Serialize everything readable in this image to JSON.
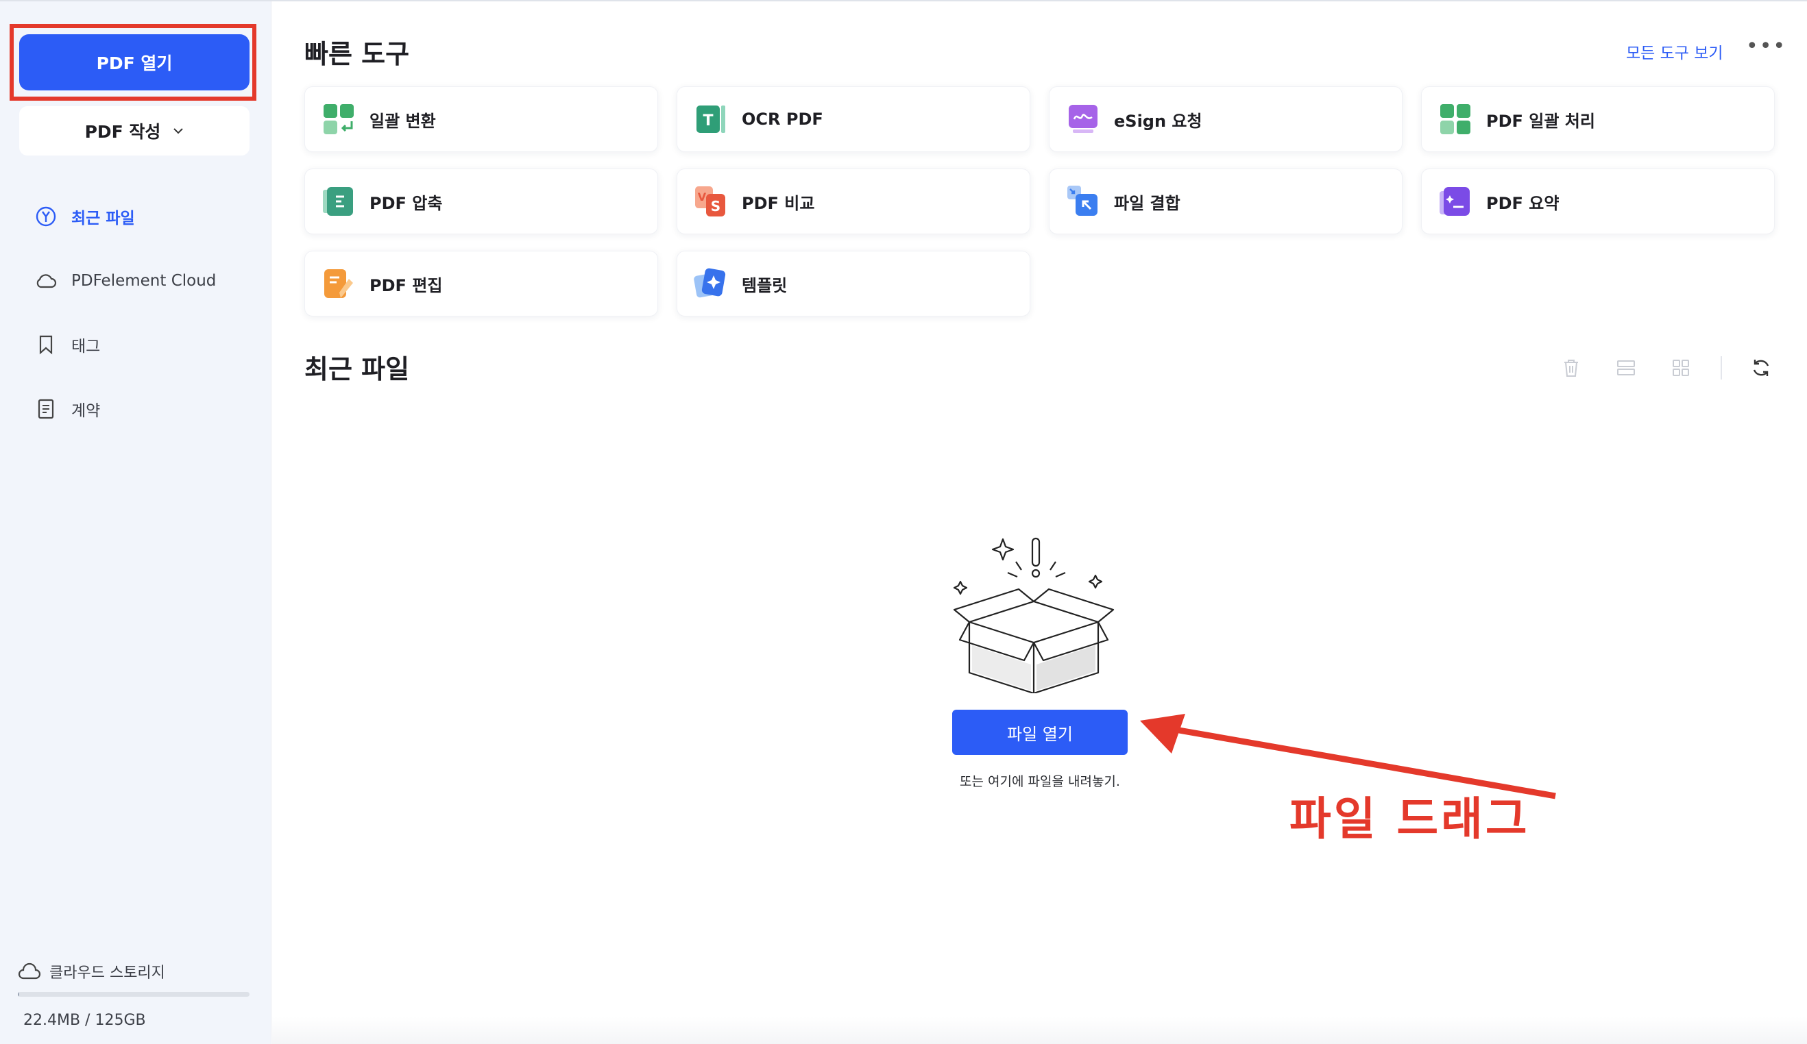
{
  "sidebar": {
    "open_pdf_label": "PDF 열기",
    "create_pdf_label": "PDF 작성",
    "nav": [
      {
        "label": "최근 파일",
        "icon": "recent-icon",
        "active": true
      },
      {
        "label": "PDFelement Cloud",
        "icon": "cloud-icon",
        "active": false
      },
      {
        "label": "태그",
        "icon": "bookmark-icon",
        "active": false
      },
      {
        "label": "계약",
        "icon": "document-icon",
        "active": false
      }
    ],
    "storage": {
      "title": "클라우드 스토리지",
      "usage": "22.4MB / 125GB",
      "used_fraction": 0.0002
    }
  },
  "quick_tools": {
    "title": "빠른 도구",
    "view_all": "모든 도구 보기",
    "more": "•••",
    "tools": [
      {
        "label": "일괄 변환",
        "icon": "batch-convert-icon"
      },
      {
        "label": "OCR PDF",
        "icon": "ocr-icon"
      },
      {
        "label": "eSign 요청",
        "icon": "esign-icon"
      },
      {
        "label": "PDF 일괄 처리",
        "icon": "batch-process-icon"
      },
      {
        "label": "PDF 압축",
        "icon": "compress-icon"
      },
      {
        "label": "PDF 비교",
        "icon": "compare-icon"
      },
      {
        "label": "파일 결합",
        "icon": "combine-icon"
      },
      {
        "label": "PDF 요약",
        "icon": "summary-icon"
      },
      {
        "label": "PDF 편집",
        "icon": "edit-icon"
      },
      {
        "label": "템플릿",
        "icon": "template-icon"
      }
    ]
  },
  "recent_files": {
    "title": "최근 파일",
    "open_file_label": "파일 열기",
    "drop_hint": "또는 여기에 파일을 내려놓기."
  },
  "annotation": {
    "text": "파일 드래그",
    "color": "#e4392b"
  },
  "colors": {
    "accent": "#2c5cf6",
    "sidebar_bg": "#f2f5fb"
  }
}
